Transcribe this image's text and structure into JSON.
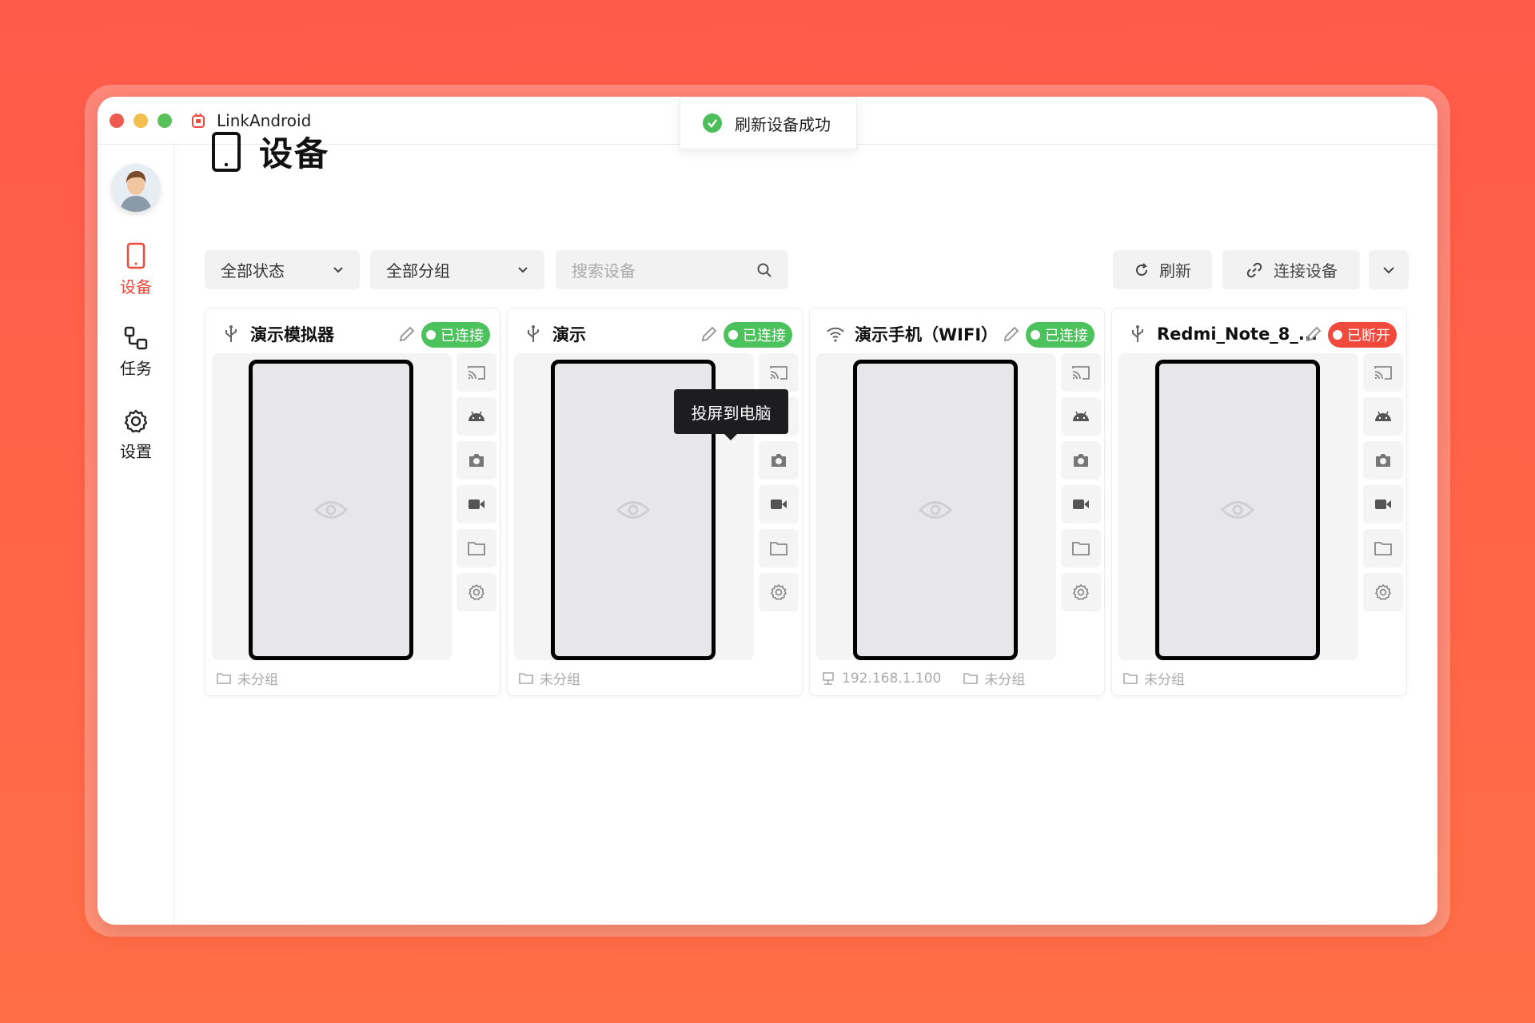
{
  "window": {
    "title": "LinkAndroid"
  },
  "toast": {
    "message": "刷新设备成功"
  },
  "sidebar": {
    "items": [
      {
        "label": "设备"
      },
      {
        "label": "任务"
      },
      {
        "label": "设置"
      }
    ]
  },
  "page": {
    "title": "设备"
  },
  "toolbar": {
    "status_filter": "全部状态",
    "group_filter": "全部分组",
    "search_placeholder": "搜索设备",
    "refresh_label": "刷新",
    "connect_label": "连接设备"
  },
  "tooltip": {
    "text": "投屏到电脑"
  },
  "devices": [
    {
      "name": "演示模拟器",
      "connection": "usb",
      "status": "已连接",
      "status_color": "#4cc25d",
      "ip": "",
      "group": "未分组"
    },
    {
      "name": "演示",
      "connection": "usb",
      "status": "已连接",
      "status_color": "#4cc25d",
      "ip": "",
      "group": "未分组"
    },
    {
      "name": "演示手机（WIFI）",
      "connection": "wifi",
      "status": "已连接",
      "status_color": "#4cc25d",
      "ip": "192.168.1.100",
      "group": "未分组"
    },
    {
      "name": "Redmi_Note_8_...",
      "connection": "usb",
      "status": "已断开",
      "status_color": "#ef4a3c",
      "ip": "",
      "group": "未分组"
    }
  ],
  "colors": {
    "accent": "#ef4a3c",
    "connected": "#4cc25d",
    "disconnected": "#ef4a3c"
  }
}
